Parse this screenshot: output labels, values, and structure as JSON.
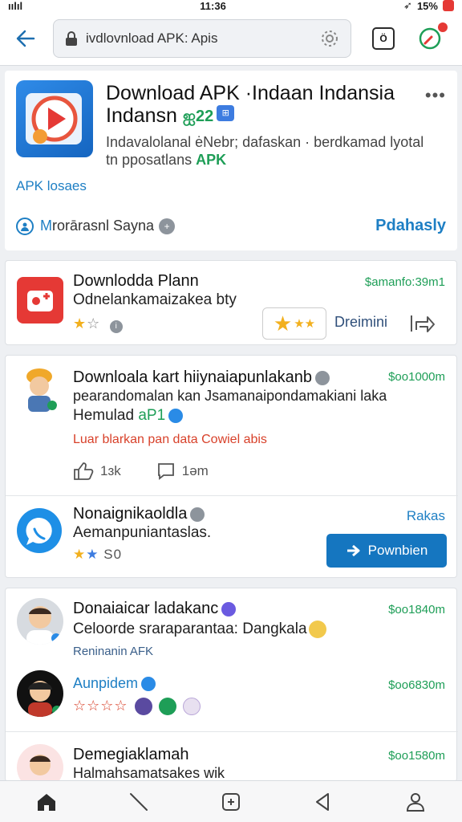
{
  "status_bar": {
    "signal": "ıılıl",
    "time": "11:36",
    "battery": "15%"
  },
  "browser": {
    "url": "ivdlovnload APK: Apis",
    "tab_label": "Ö"
  },
  "hero": {
    "title_line1": "Download APK ·Indaan Indansia",
    "title_line2": "Indansn",
    "badge_green": "ஐ22",
    "badge_blue": "⊞",
    "desc_line1": "Indavalolanal ėNebr; dafaskan · berdkamad lyotal",
    "desc_line2": "tn pposatlans",
    "desc_apk": "APK",
    "link": "APK losaes",
    "dev_first": "M",
    "dev_rest": "rorārasnl Sayna",
    "action": "Pdahasly"
  },
  "card1": {
    "title": "Downlodda Plann",
    "subtitle": "Odnelankamaizakea bty",
    "price": "$amanfo:39m1",
    "download": "Dreimini"
  },
  "card2": {
    "row1": {
      "title": "Downloala kart hiiynaiapunlakanb",
      "price": "$oo1000m",
      "subtitle": "pearandomalan kan Jsamanaipondamakiani laka",
      "line3": "Hemulad",
      "line3_badge": "aP1",
      "warning": "Luar blarkan pan data Cowiel abis",
      "likes": "1ɜk",
      "comments": "1əm"
    },
    "row2": {
      "title": "Nonaignikaoldla",
      "subtitle": "Aemanpuniantaslas.",
      "rating": "S0",
      "link": "Rakas",
      "button": "Pownbien"
    }
  },
  "card3": {
    "row1": {
      "title": "Donaiaicar ladakanc",
      "subtitle": "Celoorde sraraparantaa: Dangkala",
      "sub2": "Reninanin AFK",
      "price": "$oo1840m"
    },
    "row2": {
      "title": "Aunpidem",
      "price": "$oo6830m"
    },
    "row3": {
      "title": "Demegiaklamah",
      "subtitle": "Halmahsamatsakes wik",
      "price": "$oo1580m"
    }
  },
  "colors": {
    "accent": "#1e7fc4",
    "green": "#1e9e57",
    "red": "#e53935",
    "button": "#1576c0"
  }
}
